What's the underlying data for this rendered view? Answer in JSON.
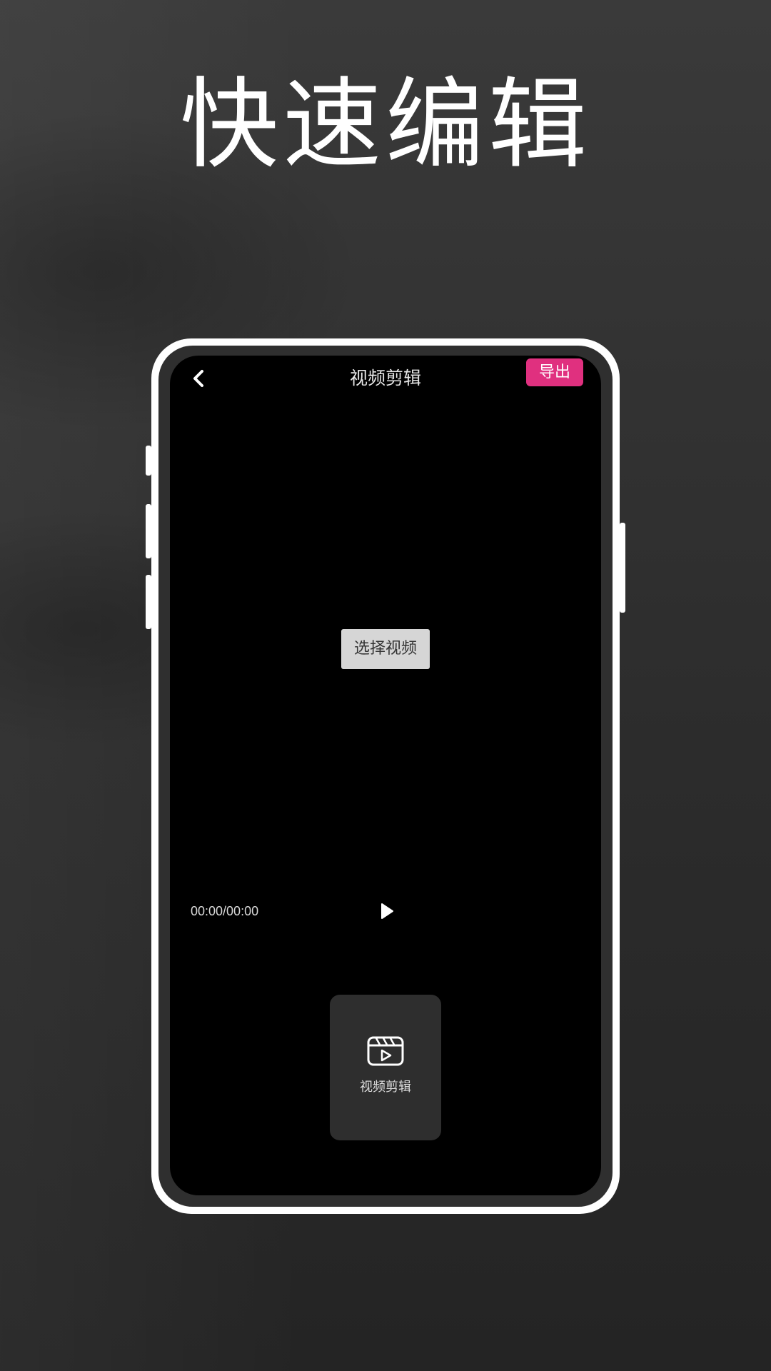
{
  "headline": "快速编辑",
  "app": {
    "title": "视频剪辑",
    "export_label": "导出",
    "select_video_label": "选择视频",
    "time_display": "00:00/00:00",
    "tools": [
      {
        "label": "视频剪辑",
        "icon": "video-clapper-icon"
      }
    ]
  },
  "colors": {
    "accent": "#e0307f",
    "screen_background": "#000000",
    "card_background": "#2e2e2e",
    "phone_frame": "#ffffff"
  }
}
